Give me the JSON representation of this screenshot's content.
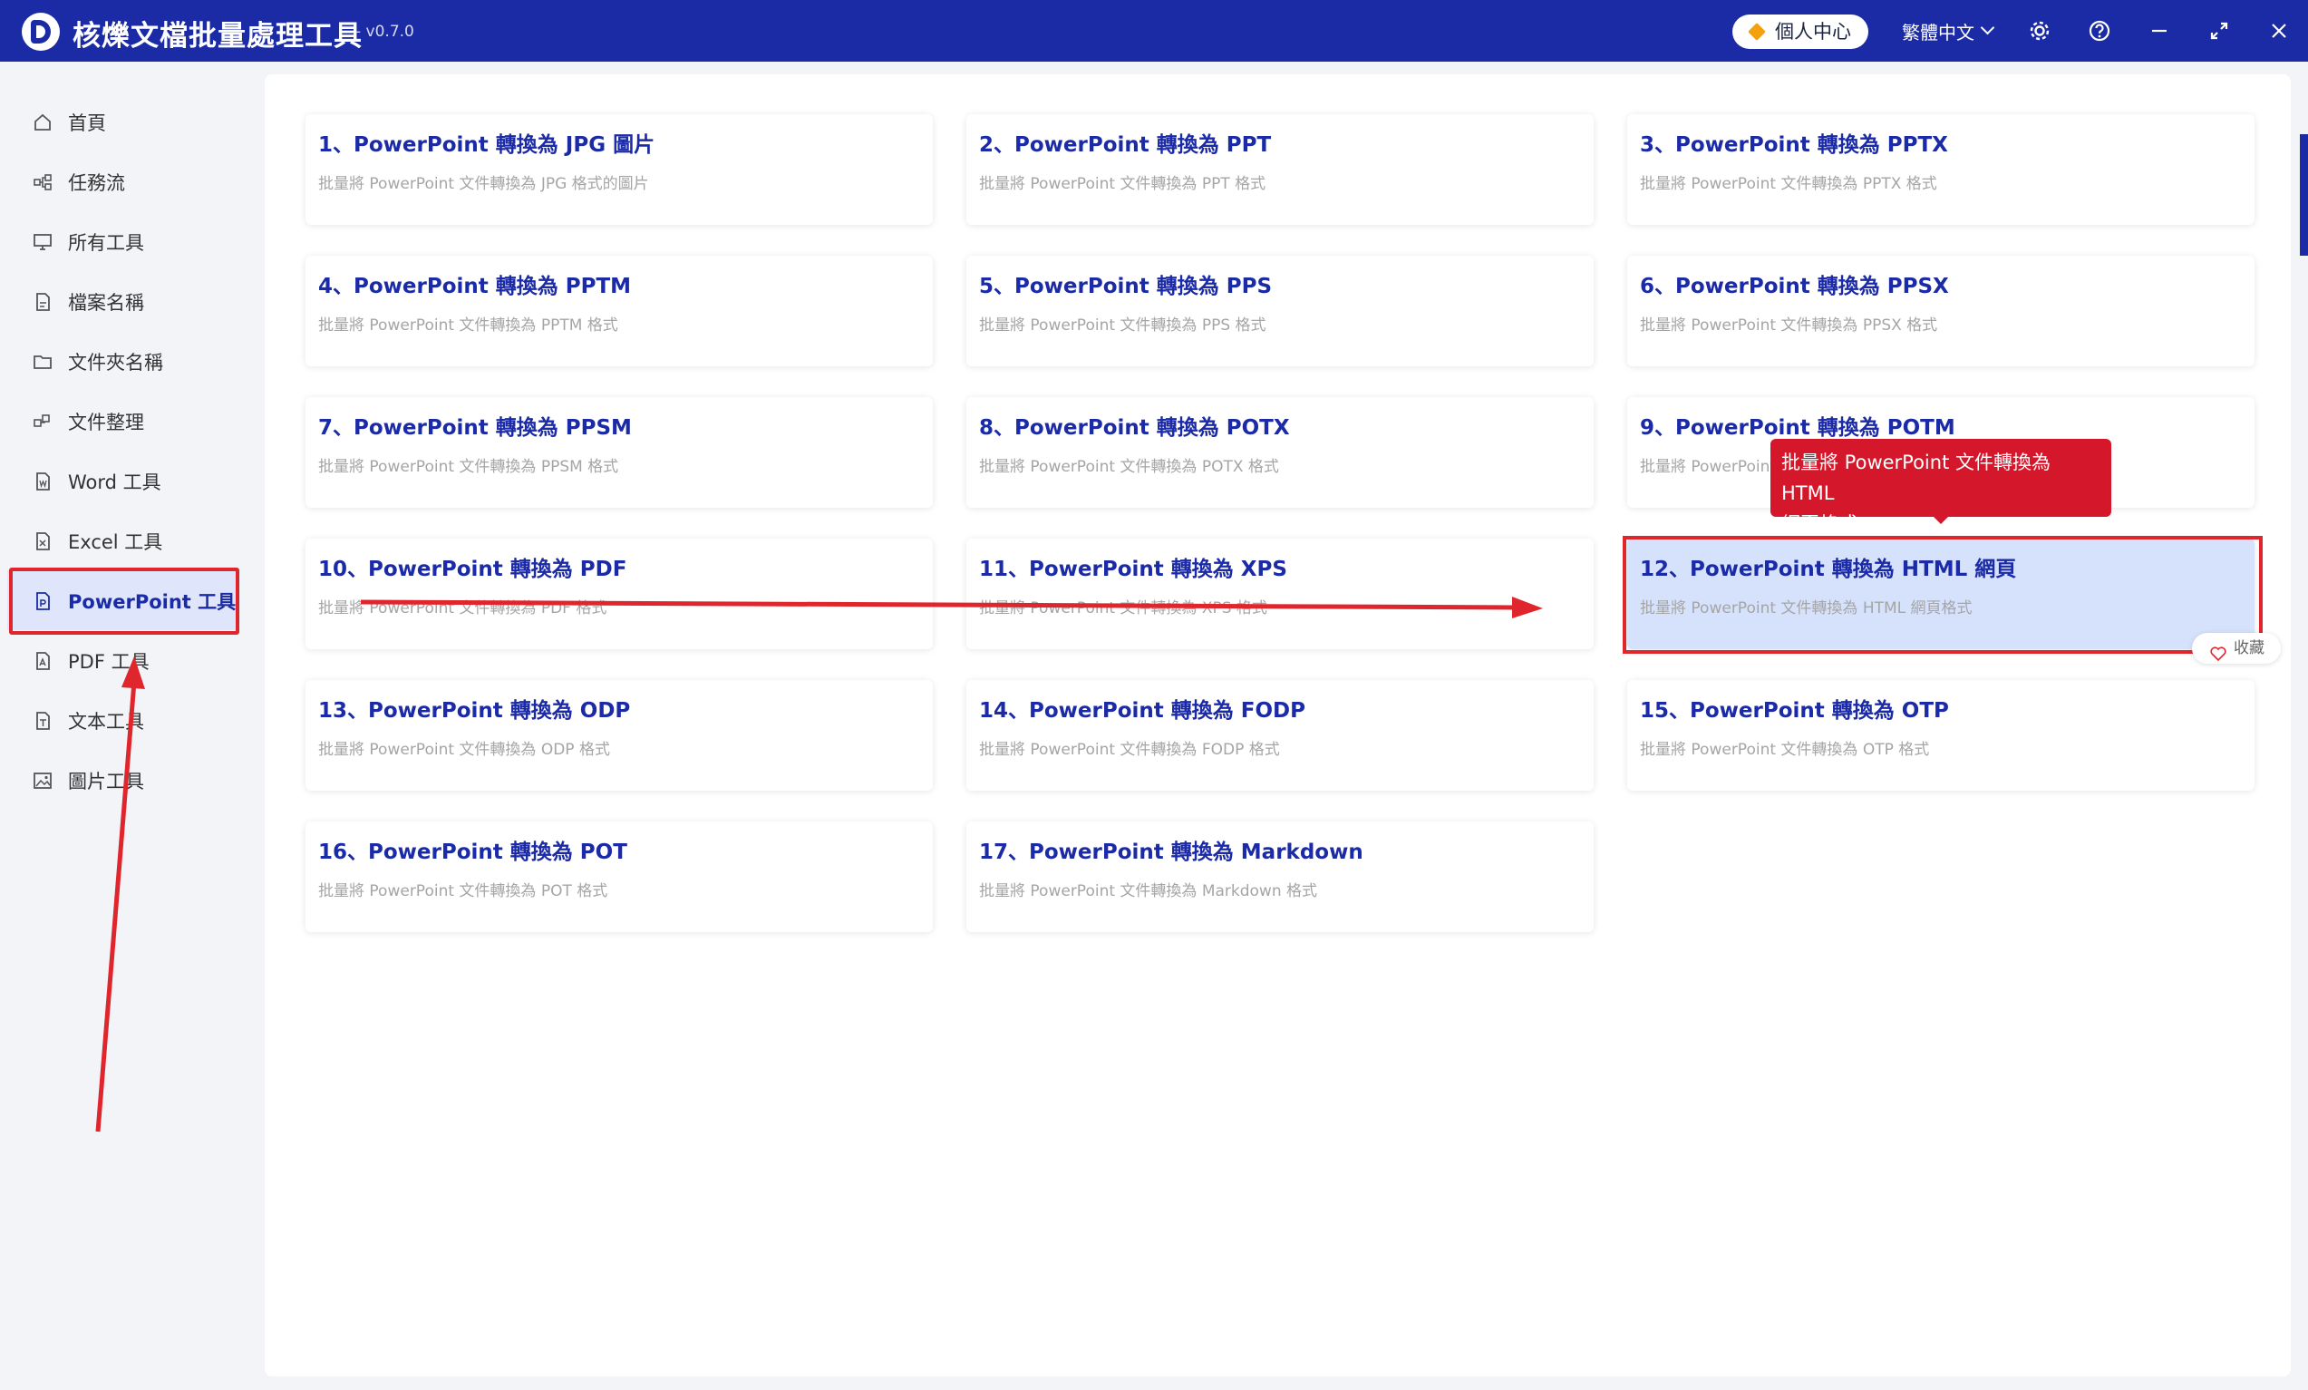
{
  "app": {
    "title": "核爍文檔批量處理工具",
    "version": "- v0.7.0",
    "user_center": "個人中心",
    "language": "繁體中文"
  },
  "sidebar": {
    "items": [
      {
        "label": "首頁",
        "icon": "home-icon"
      },
      {
        "label": "任務流",
        "icon": "workflow-icon"
      },
      {
        "label": "所有工具",
        "icon": "monitor-icon"
      },
      {
        "label": "檔案名稱",
        "icon": "file-name-icon"
      },
      {
        "label": "文件夾名稱",
        "icon": "folder-icon"
      },
      {
        "label": "文件整理",
        "icon": "organize-icon"
      },
      {
        "label": "Word 工具",
        "icon": "word-icon"
      },
      {
        "label": "Excel 工具",
        "icon": "excel-icon"
      },
      {
        "label": "PowerPoint 工具",
        "icon": "powerpoint-icon",
        "active": true
      },
      {
        "label": "PDF 工具",
        "icon": "pdf-icon"
      },
      {
        "label": "文本工具",
        "icon": "text-icon"
      },
      {
        "label": "圖片工具",
        "icon": "image-icon"
      }
    ]
  },
  "tools": [
    {
      "title": "1、PowerPoint 轉換為 JPG 圖片",
      "desc": "批量將 PowerPoint 文件轉換為 JPG 格式的圖片"
    },
    {
      "title": "2、PowerPoint 轉換為 PPT",
      "desc": "批量將 PowerPoint 文件轉換為 PPT 格式"
    },
    {
      "title": "3、PowerPoint 轉換為 PPTX",
      "desc": "批量將 PowerPoint 文件轉換為 PPTX 格式"
    },
    {
      "title": "4、PowerPoint 轉換為 PPTM",
      "desc": "批量將 PowerPoint 文件轉換為 PPTM 格式"
    },
    {
      "title": "5、PowerPoint 轉換為 PPS",
      "desc": "批量將 PowerPoint 文件轉換為 PPS 格式"
    },
    {
      "title": "6、PowerPoint 轉換為 PPSX",
      "desc": "批量將 PowerPoint 文件轉換為 PPSX 格式"
    },
    {
      "title": "7、PowerPoint 轉換為 PPSM",
      "desc": "批量將 PowerPoint 文件轉換為 PPSM 格式"
    },
    {
      "title": "8、PowerPoint 轉換為 POTX",
      "desc": "批量將 PowerPoint 文件轉換為 POTX 格式"
    },
    {
      "title": "9、PowerPoint 轉換為 POTM",
      "desc": "批量將 PowerPoint"
    },
    {
      "title": "10、PowerPoint 轉換為 PDF",
      "desc": "批量將 PowerPoint 文件轉換為 PDF 格式"
    },
    {
      "title": "11、PowerPoint 轉換為 XPS",
      "desc": "批量將 PowerPoint 文件轉換為 XPS 格式"
    },
    {
      "title": "12、PowerPoint 轉換為 HTML 網頁",
      "desc": "批量將 PowerPoint 文件轉換為 HTML 網頁格式",
      "selected": true
    },
    {
      "title": "13、PowerPoint 轉換為 ODP",
      "desc": "批量將 PowerPoint 文件轉換為 ODP 格式"
    },
    {
      "title": "14、PowerPoint 轉換為 FODP",
      "desc": "批量將 PowerPoint 文件轉換為 FODP 格式"
    },
    {
      "title": "15、PowerPoint 轉換為 OTP",
      "desc": "批量將 PowerPoint 文件轉換為 OTP 格式"
    },
    {
      "title": "16、PowerPoint 轉換為 POT",
      "desc": "批量將 PowerPoint 文件轉換為 POT 格式"
    },
    {
      "title": "17、PowerPoint 轉換為 Markdown",
      "desc": "批量將 PowerPoint 文件轉換為 Markdown 格式"
    }
  ],
  "tooltip": {
    "line1": "批量將 PowerPoint 文件轉換為 HTML",
    "line2": "網頁格式"
  },
  "favorite_label": "收藏",
  "colors": {
    "brand": "#1b2ba6",
    "annotation": "#e0262d",
    "tooltip": "#d4172a",
    "selected_card": "#d6e2fb"
  }
}
